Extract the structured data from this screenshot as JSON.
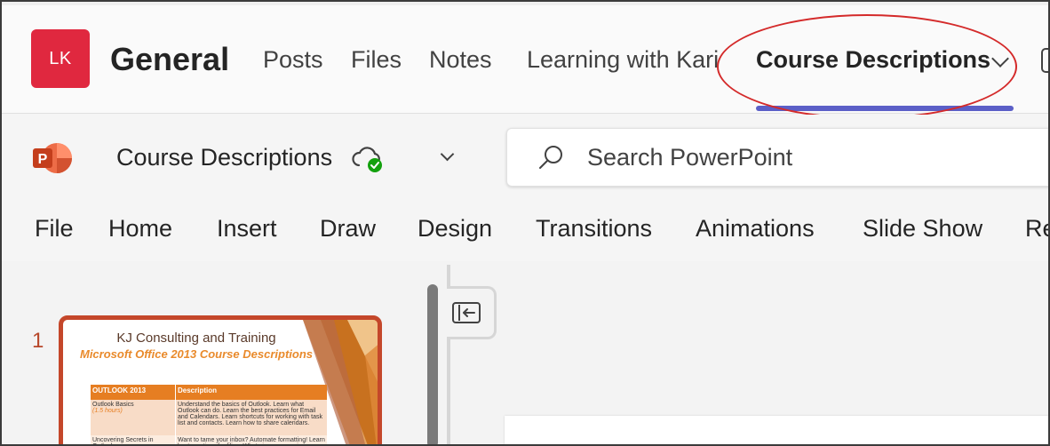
{
  "teams": {
    "avatar_initials": "LK",
    "channel_title": "General",
    "tabs": [
      {
        "label": "Posts"
      },
      {
        "label": "Files"
      },
      {
        "label": "Notes"
      },
      {
        "label": "Learning with Kari"
      },
      {
        "label": "Course Descriptions",
        "active": true
      }
    ],
    "accent_color": "#5b5fc7",
    "avatar_color": "#e0283f",
    "annotation_color": "#d42a2a"
  },
  "powerpoint": {
    "document_title": "Course Descriptions",
    "search_placeholder": "Search PowerPoint",
    "sync_status_icon": "cloud-check-icon",
    "ribbon_tabs": [
      "File",
      "Home",
      "Insert",
      "Draw",
      "Design",
      "Transitions",
      "Animations",
      "Slide Show",
      "Re"
    ],
    "brand_color": "#c4472a"
  },
  "slides": [
    {
      "number": "1",
      "title": "KJ Consulting and Training",
      "subtitle": "Microsoft Office 2013 Course Descriptions",
      "table": {
        "headers": [
          "OUTLOOK 2013",
          "Description"
        ],
        "rows": [
          {
            "name": "Outlook Basics",
            "hours": "(1.5 hours)",
            "description": "Understand the basics of Outlook.  Learn what Outlook can do. Learn the best practices for Email and Calendars. Learn shortcuts for working with task list and contacts. Learn how to share calendars."
          },
          {
            "name": "Uncovering Secrets in Outlook",
            "hours": "",
            "description": "Want to tame your inbox? Automate formatting! Learn best practices for filing. What view can maximize your time. What"
          }
        ]
      }
    }
  ]
}
